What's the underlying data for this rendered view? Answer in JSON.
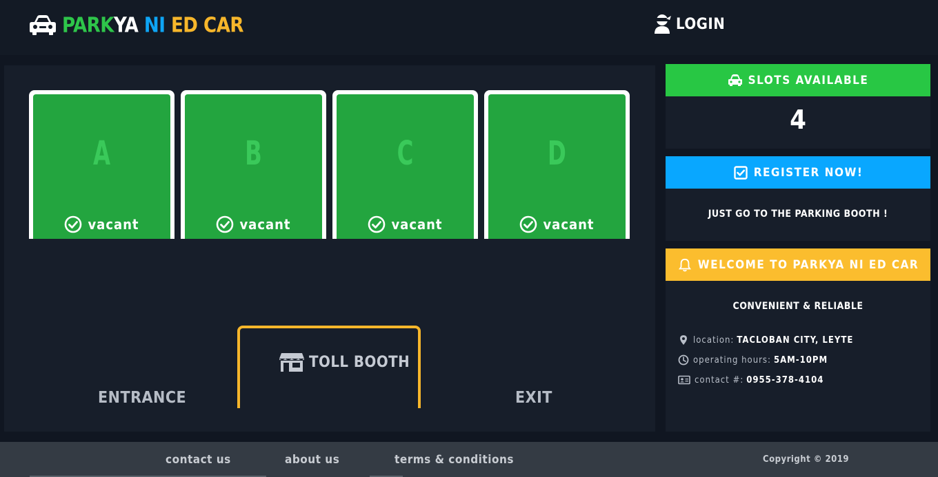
{
  "header": {
    "brand": {
      "part1": "PARK",
      "part2": "YA",
      "part3": "NI",
      "part4": "ED CAR",
      "colors": {
        "part1": "#2ec54a",
        "part2": "#ffffff",
        "part3": "#0ea5f5",
        "part4": "#f6b62b"
      }
    },
    "login_label": "LOGIN"
  },
  "slots": [
    {
      "letter": "A",
      "status": "vacant"
    },
    {
      "letter": "B",
      "status": "vacant"
    },
    {
      "letter": "C",
      "status": "vacant"
    },
    {
      "letter": "D",
      "status": "vacant"
    }
  ],
  "lot": {
    "toll_booth_label": "TOLL BOOTH",
    "entrance_label": "ENTRANCE",
    "exit_label": "EXIT"
  },
  "sidebar": {
    "slots_card": {
      "title": "SLOTS AVAILABLE",
      "count": "4",
      "color": "#28c744"
    },
    "register_card": {
      "title": "REGISTER NOW!",
      "text": "JUST GO TO THE PARKING BOOTH !",
      "color": "#09a7ff"
    },
    "welcome_card": {
      "title": "WELCOME TO PARKYA NI ED CAR",
      "tagline": "CONVENIENT & RELIABLE",
      "color": "#fbbd2e",
      "location_label": "location:",
      "location_value": "TACLOBAN CITY, LEYTE",
      "hours_label": "operating hours:",
      "hours_value": "5AM-10PM",
      "contact_label": "contact #:",
      "contact_value": "0955-378-4104"
    }
  },
  "footer": {
    "links": [
      "contact us",
      "about us",
      "terms & conditions"
    ],
    "copyright": "Copyright © 2019"
  }
}
